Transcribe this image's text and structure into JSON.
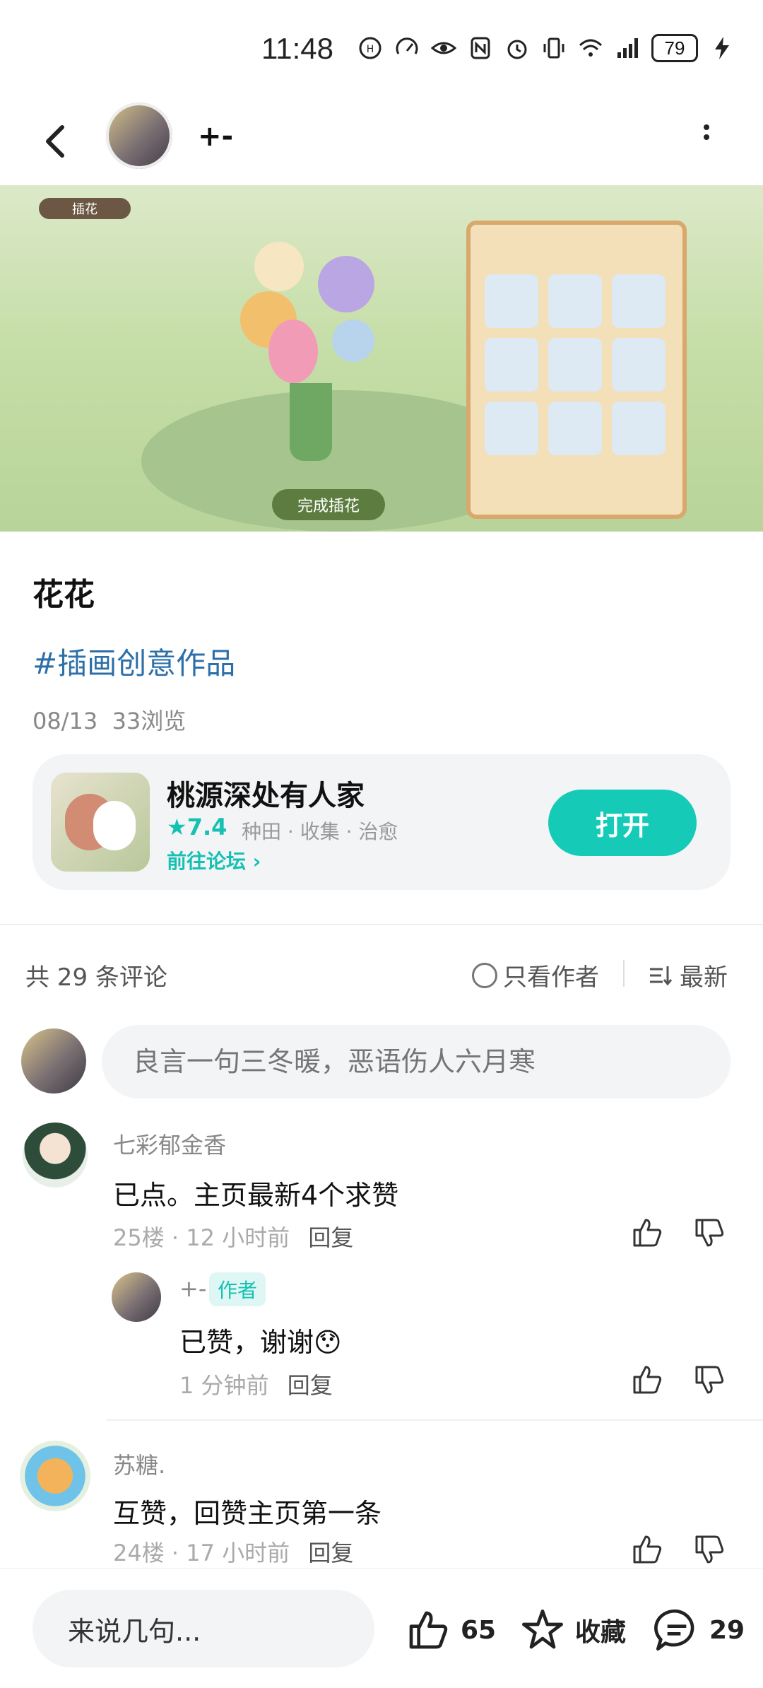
{
  "status_bar": {
    "time": "11:48",
    "battery": "79"
  },
  "header": {
    "author_name": "+-"
  },
  "game_screenshot": {
    "tab_label": "插花",
    "finish_button": "完成插花"
  },
  "post": {
    "title": "花花",
    "tag": "#插画创意作品",
    "date": "08/13",
    "views": "33浏览"
  },
  "game_card": {
    "name": "桃源深处有人家",
    "rating": "★7.4",
    "tags": "种田 · 收集 · 治愈",
    "forum_link": "前往论坛 ›",
    "open_label": "打开"
  },
  "comments_header": {
    "count_label": "共 29 条评论",
    "only_author_label": "只看作者",
    "sort_label": "最新"
  },
  "comment_input": {
    "placeholder": "良言一句三冬暖，恶语伤人六月寒"
  },
  "comments": [
    {
      "name": "七彩郁金香",
      "text": "已点。主页最新4个求赞",
      "floor": "25楼",
      "time": "12 小时前",
      "reply_label": "回复",
      "replies": [
        {
          "name": "+-",
          "badge": "作者",
          "text": "已赞，谢谢",
          "emoji": "😯",
          "time": "1 分钟前",
          "reply_label": "回复"
        }
      ]
    },
    {
      "name": "苏糖.",
      "text": "互赞，回赞主页第一条",
      "floor": "24楼",
      "time": "17 小时前",
      "reply_label": "回复"
    }
  ],
  "bottom_bar": {
    "input_placeholder": "来说几句...",
    "like_count": "65",
    "favorite_label": "收藏",
    "comment_count": "29"
  },
  "colors": {
    "accent": "#15cbb8",
    "tag_blue": "#2d6fa8"
  }
}
